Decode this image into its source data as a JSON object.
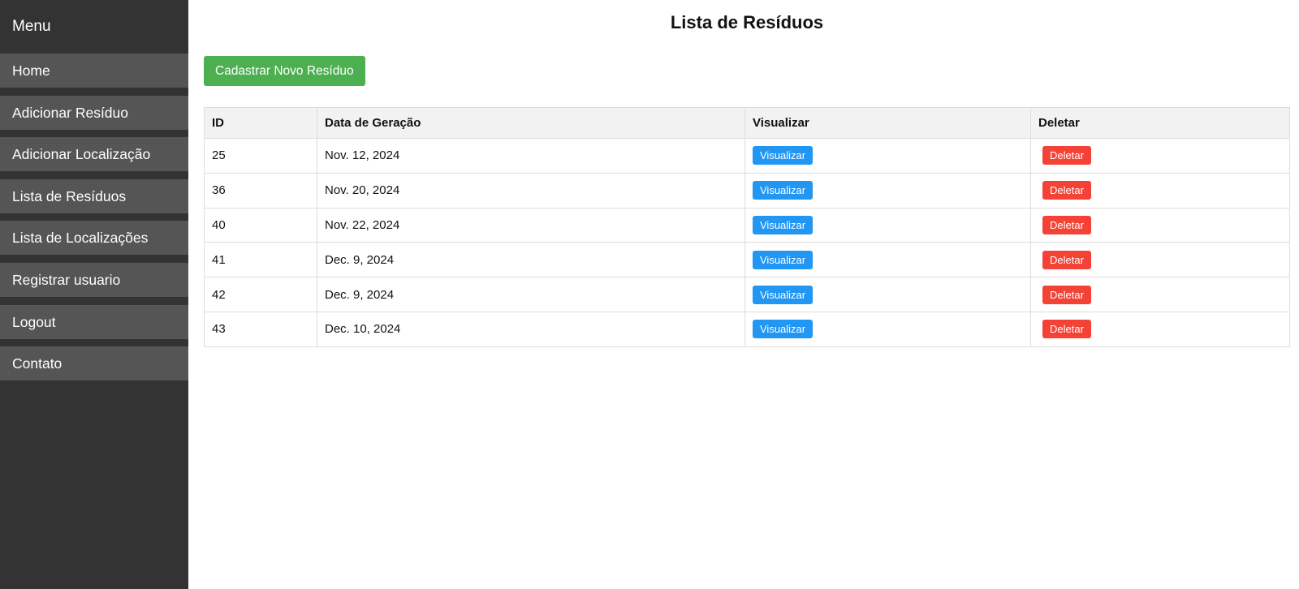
{
  "sidebar": {
    "title": "Menu",
    "items": [
      {
        "label": "Home"
      },
      {
        "label": "Adicionar Resíduo"
      },
      {
        "label": "Adicionar Localização"
      },
      {
        "label": "Lista de Resíduos"
      },
      {
        "label": "Lista de Localizações"
      },
      {
        "label": "Registrar usuario"
      },
      {
        "label": "Logout"
      },
      {
        "label": "Contato"
      }
    ]
  },
  "main": {
    "title": "Lista de Resíduos",
    "add_button_label": "Cadastrar Novo Resíduo",
    "table": {
      "headers": [
        "ID",
        "Data de Geração",
        "Visualizar",
        "Deletar"
      ],
      "rows": [
        {
          "id": "25",
          "date": "Nov. 12, 2024",
          "view_label": "Visualizar",
          "delete_label": "Deletar"
        },
        {
          "id": "36",
          "date": "Nov. 20, 2024",
          "view_label": "Visualizar",
          "delete_label": "Deletar"
        },
        {
          "id": "40",
          "date": "Nov. 22, 2024",
          "view_label": "Visualizar",
          "delete_label": "Deletar"
        },
        {
          "id": "41",
          "date": "Dec. 9, 2024",
          "view_label": "Visualizar",
          "delete_label": "Deletar"
        },
        {
          "id": "42",
          "date": "Dec. 9, 2024",
          "view_label": "Visualizar",
          "delete_label": "Deletar"
        },
        {
          "id": "43",
          "date": "Dec. 10, 2024",
          "view_label": "Visualizar",
          "delete_label": "Deletar"
        }
      ]
    }
  },
  "colors": {
    "sidebar_bg": "#333333",
    "nav_item_bg": "#555555",
    "primary_green": "#4caf50",
    "view_blue": "#2196f3",
    "delete_red": "#f44336",
    "table_header_bg": "#f2f2f2"
  }
}
